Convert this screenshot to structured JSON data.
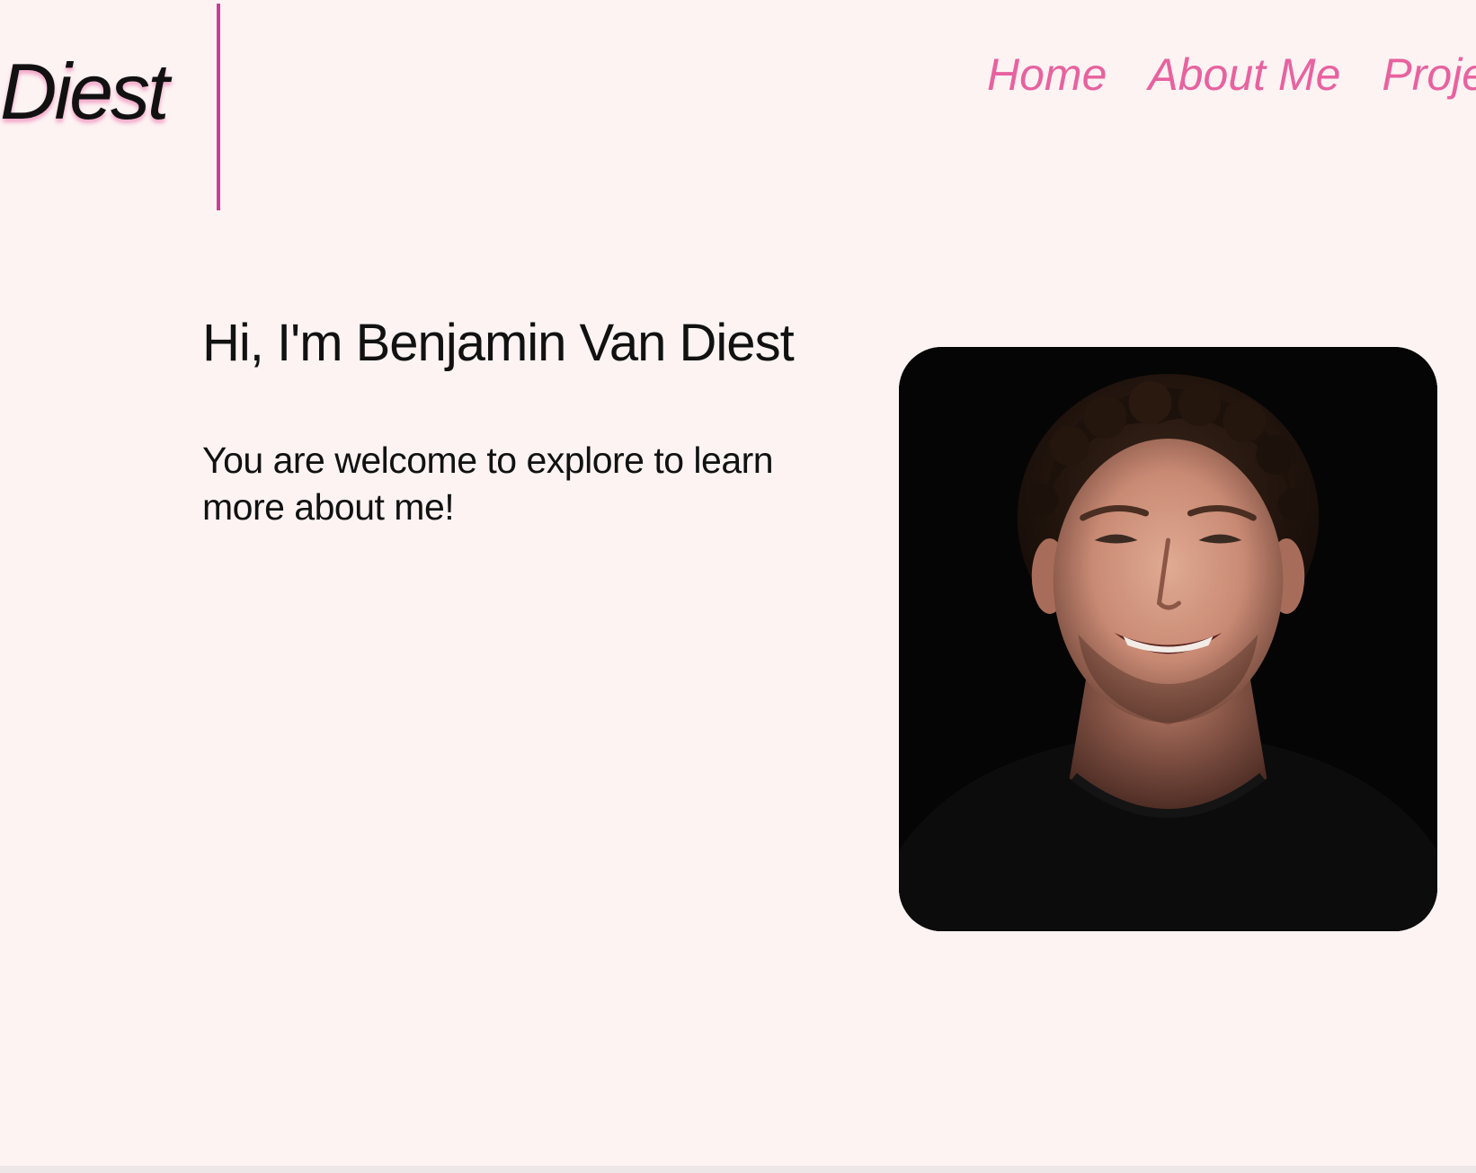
{
  "logo": {
    "text": "Diest"
  },
  "nav": {
    "items": [
      {
        "label": "Home"
      },
      {
        "label": "About Me"
      },
      {
        "label": "Projects"
      }
    ]
  },
  "hero": {
    "title": "Hi, I'm Benjamin Van Diest",
    "subtitle": "You are welcome to explore to learn more about me!"
  },
  "colors": {
    "background": "#fdf3f3",
    "accent": "#e8629f",
    "divider": "#cc3d95",
    "text": "#111111"
  }
}
